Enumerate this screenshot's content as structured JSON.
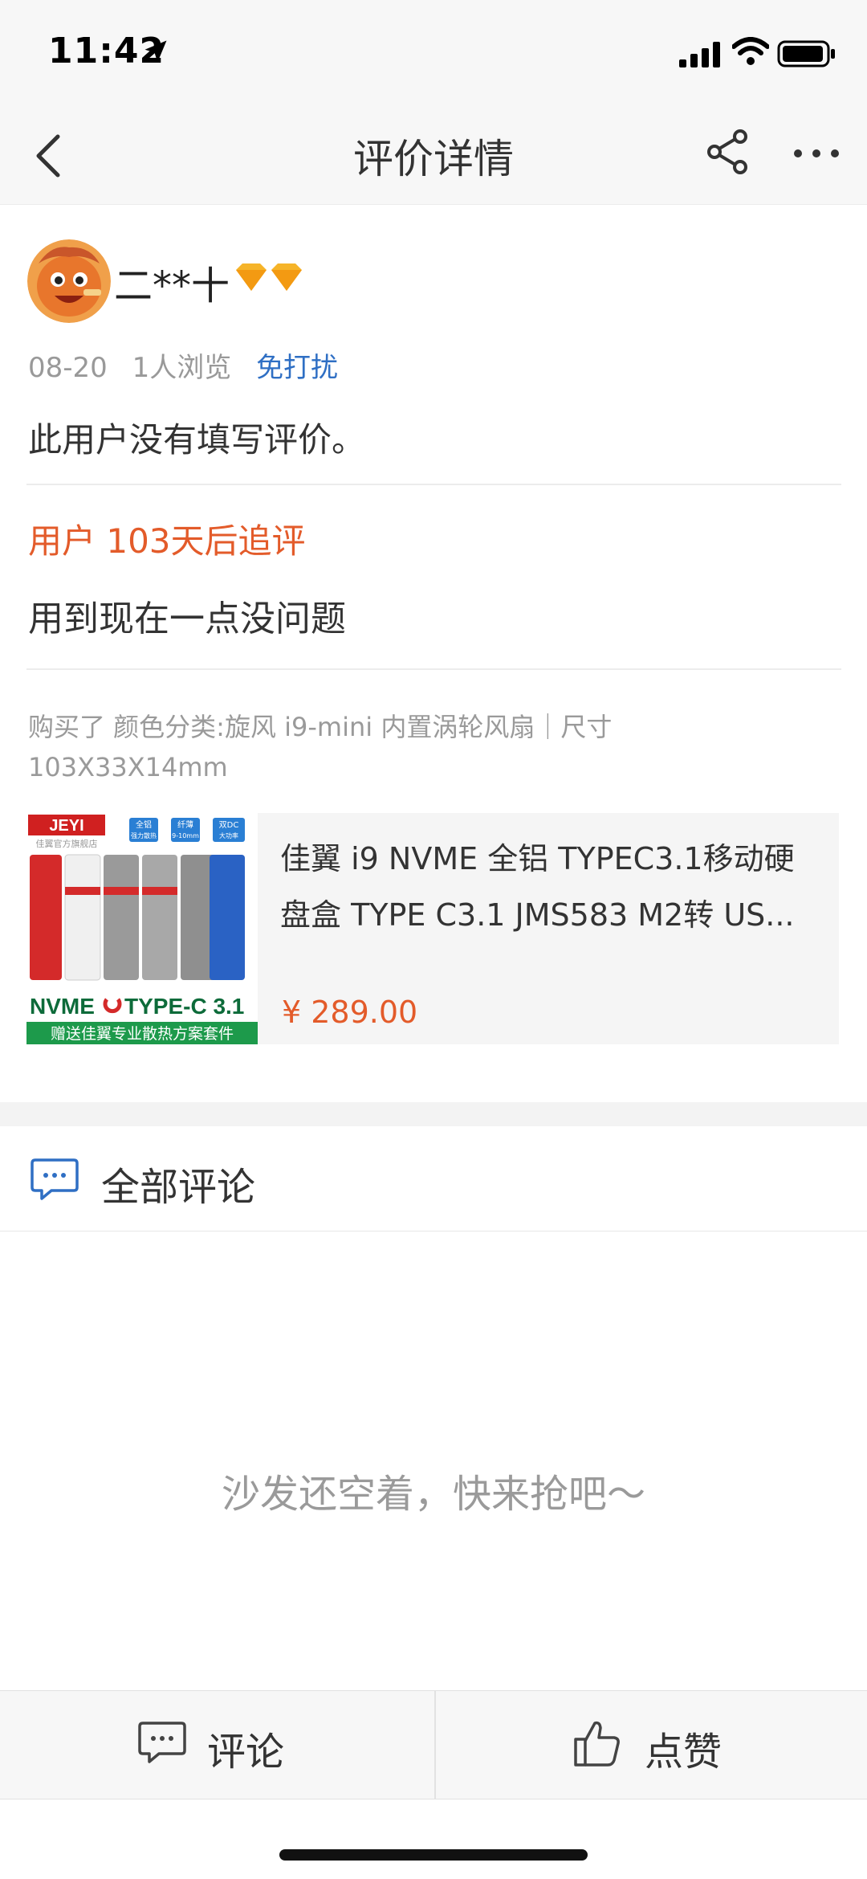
{
  "status_bar": {
    "time": "11:42"
  },
  "nav": {
    "title": "评价详情"
  },
  "review": {
    "user_name": "二**十",
    "date": "08-20",
    "views": "1人浏览",
    "dnd_link": "免打扰",
    "text": "此用户没有填写评价。",
    "followup_title": "用户 103天后追评",
    "followup_text": "用到现在一点没问题",
    "purchase_line1": "购买了 颜色分类:旋风 i9-mini 内置涡轮风扇｜尺寸",
    "purchase_line2": "103X33X14mm"
  },
  "product": {
    "title_line1": "佳翼 i9 NVME 全铝 TYPEC3.1移动硬",
    "title_line2": "盘盒 TYPE C3.1 JMS583 M2转 US...",
    "price": "¥ 289.00",
    "image_text": {
      "brand": "JEYI",
      "store": "佳翼官方旗舰店",
      "badge1": "全铝",
      "badge1_sub": "强力散热",
      "badge2": "纤薄",
      "badge2_sub": "9-10mm",
      "badge3": "双DC",
      "badge3_sub": "大功率",
      "banner_left": "NVME",
      "banner_right": "TYPE-C 3.1",
      "footer": "赠送佳翼专业散热方案套件"
    }
  },
  "comments": {
    "title": "全部评论",
    "empty_text": "沙发还空着，快来抢吧～"
  },
  "bottom_bar": {
    "comment_label": "评论",
    "like_label": "点赞"
  },
  "colors": {
    "accent_orange": "#e35b2a",
    "link_blue": "#2f6fc4"
  }
}
